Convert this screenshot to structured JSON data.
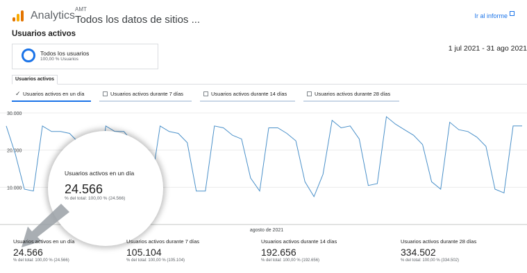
{
  "header": {
    "app_name": "Analytics",
    "account": "AMT",
    "property": "Todos los datos de sitios ...",
    "report_link": "Ir al informe",
    "logo_icon": "analytics-bars-icon",
    "external_icon": "external-link-icon"
  },
  "page": {
    "title": "Usuarios activos",
    "date_range": "1 jul 2021 - 31 ago 2021"
  },
  "segment": {
    "name": "Todos los usuarios",
    "subtitle": "100,00 % Usuarios",
    "color": "#1a73e8"
  },
  "tab": {
    "label": "Usuarios activos"
  },
  "metric_options": [
    {
      "label": "Usuarios activos en un día",
      "checked": true
    },
    {
      "label": "Usuarios activos durante 7 días",
      "checked": false
    },
    {
      "label": "Usuarios activos durante 14 días",
      "checked": false
    },
    {
      "label": "Usuarios activos durante 28 días",
      "checked": false
    }
  ],
  "chart_data": {
    "type": "line",
    "series": [
      {
        "values": [
          26500,
          19000,
          9500,
          9000,
          26500,
          25000,
          25000,
          24500,
          22000,
          9000,
          9000,
          26500,
          25000,
          25000,
          22000,
          10500,
          10500,
          26500,
          25000,
          24500,
          22000,
          9000,
          9000,
          26500,
          26000,
          24000,
          23000,
          12500,
          9000,
          26000,
          26000,
          24500,
          22500,
          11500,
          7500,
          13500,
          28000,
          26000,
          26500,
          23000,
          10500,
          11000,
          29000,
          27000,
          25500,
          24000,
          21500,
          11500,
          9500,
          27500,
          25500,
          25000,
          23500,
          21000,
          9500,
          8500,
          26500,
          26500
        ]
      }
    ],
    "y_ticks": [
      "30.000",
      "20.000",
      "10.000"
    ],
    "ylim": [
      0,
      30000
    ],
    "x_label": "agosto de 2021",
    "grid": true,
    "line_color": "#4a90c9"
  },
  "zoom": {
    "title": "Usuarios activos en un día",
    "value": "24.566",
    "subtitle": "% del total: 100,00 % (24.566)"
  },
  "summary": [
    {
      "label": "Usuarios activos en un día",
      "value": "24.566",
      "sub": "% del total: 100,00 % (24.566)"
    },
    {
      "label": "Usuarios activos durante 7 días",
      "value": "105.104",
      "sub": "% del total: 100,00 % (105.104)"
    },
    {
      "label": "Usuarios activos durante 14 días",
      "value": "192.656",
      "sub": "% del total: 100,00 % (192.656)"
    },
    {
      "label": "Usuarios activos durante 28 días",
      "value": "334.502",
      "sub": "% del total: 100,00 % (334.502)"
    }
  ]
}
